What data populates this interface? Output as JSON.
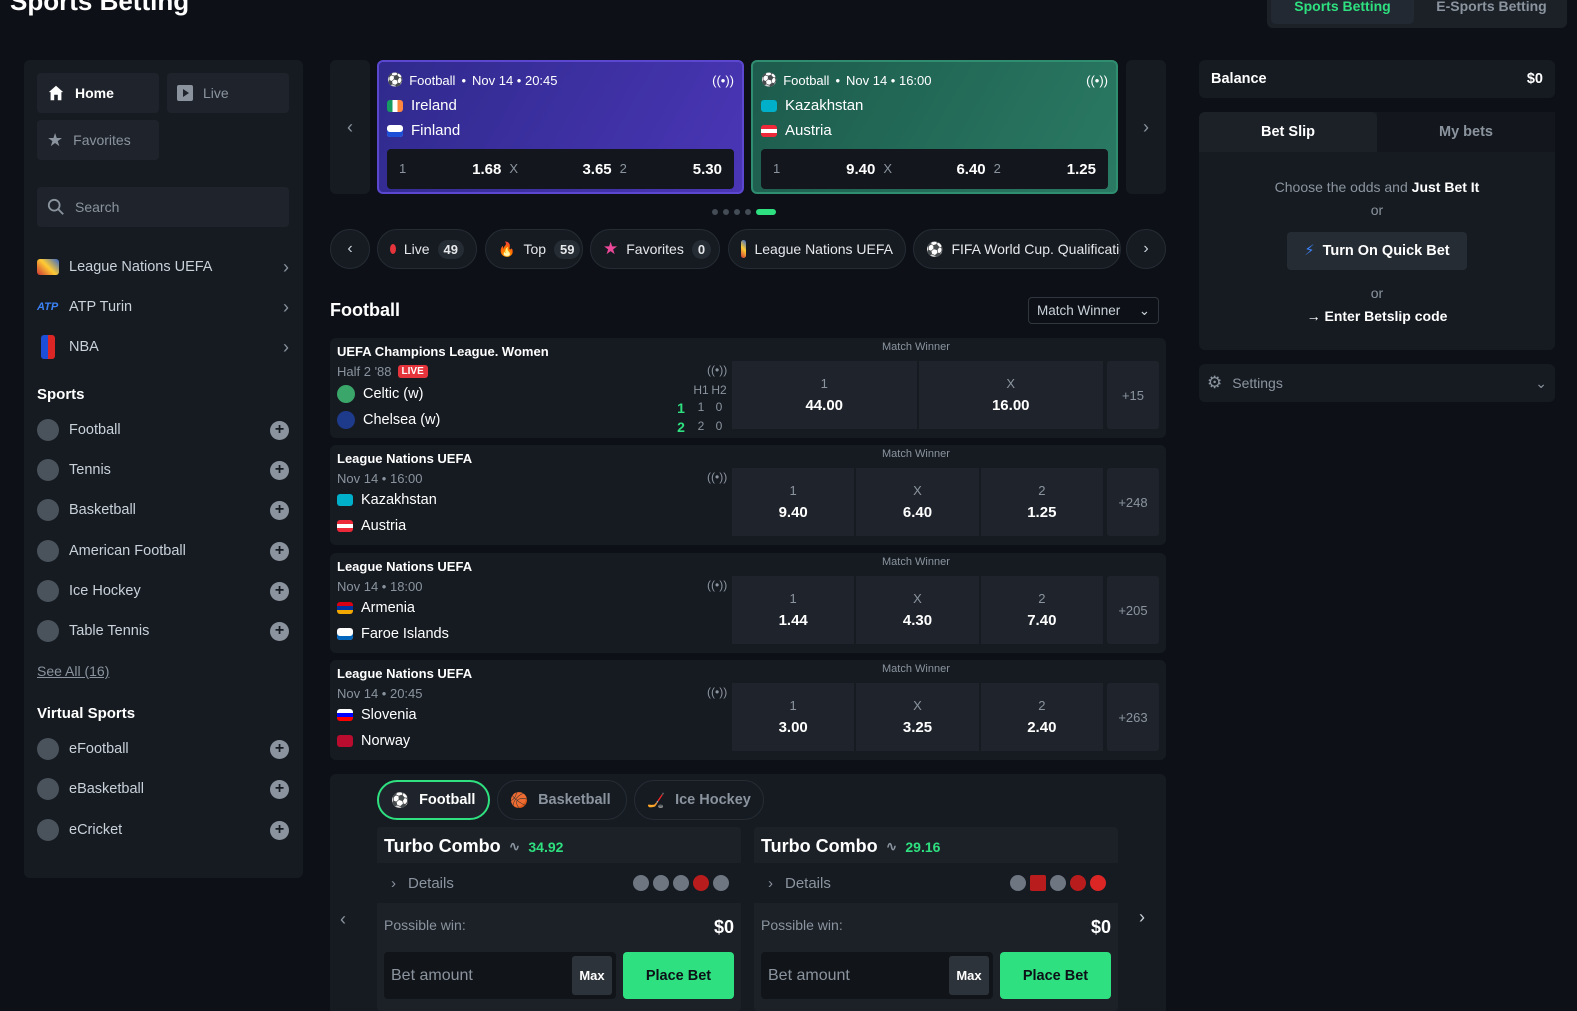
{
  "page_title": "Sports Betting",
  "top_switch": {
    "sports": "Sports Betting",
    "esports": "E-Sports Betting"
  },
  "sidebar": {
    "home": "Home",
    "live": "Live",
    "favorites": "Favorites",
    "search_placeholder": "Search",
    "leagues": [
      {
        "label": "League Nations UEFA",
        "icon": "uefa-flag-icon"
      },
      {
        "label": "ATP Turin",
        "icon": "atp-icon"
      },
      {
        "label": "NBA",
        "icon": "nba-icon"
      }
    ],
    "sports_heading": "Sports",
    "sports": [
      {
        "label": "Football",
        "icon": "football-icon"
      },
      {
        "label": "Tennis",
        "icon": "tennis-icon"
      },
      {
        "label": "Basketball",
        "icon": "basketball-icon"
      },
      {
        "label": "American Football",
        "icon": "american-football-icon"
      },
      {
        "label": "Ice Hockey",
        "icon": "ice-hockey-icon"
      },
      {
        "label": "Table Tennis",
        "icon": "table-tennis-icon"
      }
    ],
    "see_all": "See All (16)",
    "virtual_heading": "Virtual Sports",
    "virtual": [
      {
        "label": "eFootball",
        "icon": "efootball-icon"
      },
      {
        "label": "eBasketball",
        "icon": "ebasketball-icon"
      },
      {
        "label": "eCricket",
        "icon": "ecricket-icon"
      }
    ]
  },
  "featured": [
    {
      "sport": "Football",
      "sep": "•",
      "datetime": "Nov 14 • 20:45",
      "team1": "Ireland",
      "team2": "Finland",
      "l1": "1",
      "o1": "1.68",
      "lx": "X",
      "ox": "3.65",
      "l2": "2",
      "o2": "5.30"
    },
    {
      "sport": "Football",
      "sep": "•",
      "datetime": "Nov 14 • 16:00",
      "team1": "Kazakhstan",
      "team2": "Austria",
      "l1": "1",
      "o1": "9.40",
      "lx": "X",
      "ox": "6.40",
      "l2": "2",
      "o2": "1.25"
    }
  ],
  "filters": [
    {
      "label": "Live",
      "count": "49"
    },
    {
      "label": "Top",
      "count": "59"
    },
    {
      "label": "Favorites",
      "count": "0"
    },
    {
      "label": "League Nations UEFA"
    },
    {
      "label": "FIFA World Cup. Qualificatio"
    }
  ],
  "section_title": "Football",
  "market_select": "Match Winner",
  "matches": [
    {
      "league": "UEFA Champions League. Women",
      "sub": "Half 2 '88",
      "live": "LIVE",
      "team1": "Celtic (w)",
      "team2": "Chelsea (w)",
      "market": "Match Winner",
      "odds": [
        {
          "l": "1",
          "v": "44.00"
        },
        {
          "l": "X",
          "v": "16.00"
        }
      ],
      "more": "+15",
      "score": {
        "h1": "H1",
        "h2": "H2",
        "t1": [
          "1",
          "1",
          "0"
        ],
        "t2": [
          "2",
          "2",
          "0"
        ]
      }
    },
    {
      "league": "League Nations UEFA",
      "sub": "Nov 14 • 16:00",
      "team1": "Kazakhstan",
      "team2": "Austria",
      "market": "Match Winner",
      "odds": [
        {
          "l": "1",
          "v": "9.40"
        },
        {
          "l": "X",
          "v": "6.40"
        },
        {
          "l": "2",
          "v": "1.25"
        }
      ],
      "more": "+248"
    },
    {
      "league": "League Nations UEFA",
      "sub": "Nov 14 • 18:00",
      "team1": "Armenia",
      "team2": "Faroe Islands",
      "market": "Match Winner",
      "odds": [
        {
          "l": "1",
          "v": "1.44"
        },
        {
          "l": "X",
          "v": "4.30"
        },
        {
          "l": "2",
          "v": "7.40"
        }
      ],
      "more": "+205"
    },
    {
      "league": "League Nations UEFA",
      "sub": "Nov 14 • 20:45",
      "team1": "Slovenia",
      "team2": "Norway",
      "market": "Match Winner",
      "odds": [
        {
          "l": "1",
          "v": "3.00"
        },
        {
          "l": "X",
          "v": "3.25"
        },
        {
          "l": "2",
          "v": "2.40"
        }
      ],
      "more": "+263"
    }
  ],
  "combo_tabs": [
    "Football",
    "Basketball",
    "Ice Hockey"
  ],
  "combos": [
    {
      "title": "Turbo Combo",
      "value": "34.92",
      "details": "Details",
      "possible_win": "Possible win:",
      "win_value": "$0",
      "bet_placeholder": "Bet amount",
      "max": "Max",
      "place": "Place Bet"
    },
    {
      "title": "Turbo Combo",
      "value": "29.16",
      "details": "Details",
      "possible_win": "Possible win:",
      "win_value": "$0",
      "bet_placeholder": "Bet amount",
      "max": "Max",
      "place": "Place Bet"
    }
  ],
  "balance": {
    "label": "Balance",
    "value": "$0"
  },
  "betslip": {
    "tab_slip": "Bet Slip",
    "tab_my": "My bets",
    "choose": "Choose the odds and ",
    "just_bet": "Just Bet It",
    "or": "or",
    "quick": "Turn On Quick Bet",
    "or2": "or",
    "code": "→ Enter Betslip code"
  },
  "settings": "Settings",
  "colors": {
    "accent": "#2ee07f",
    "live": "#e5343b",
    "bg": "#0d1117",
    "panel": "#161b22"
  }
}
